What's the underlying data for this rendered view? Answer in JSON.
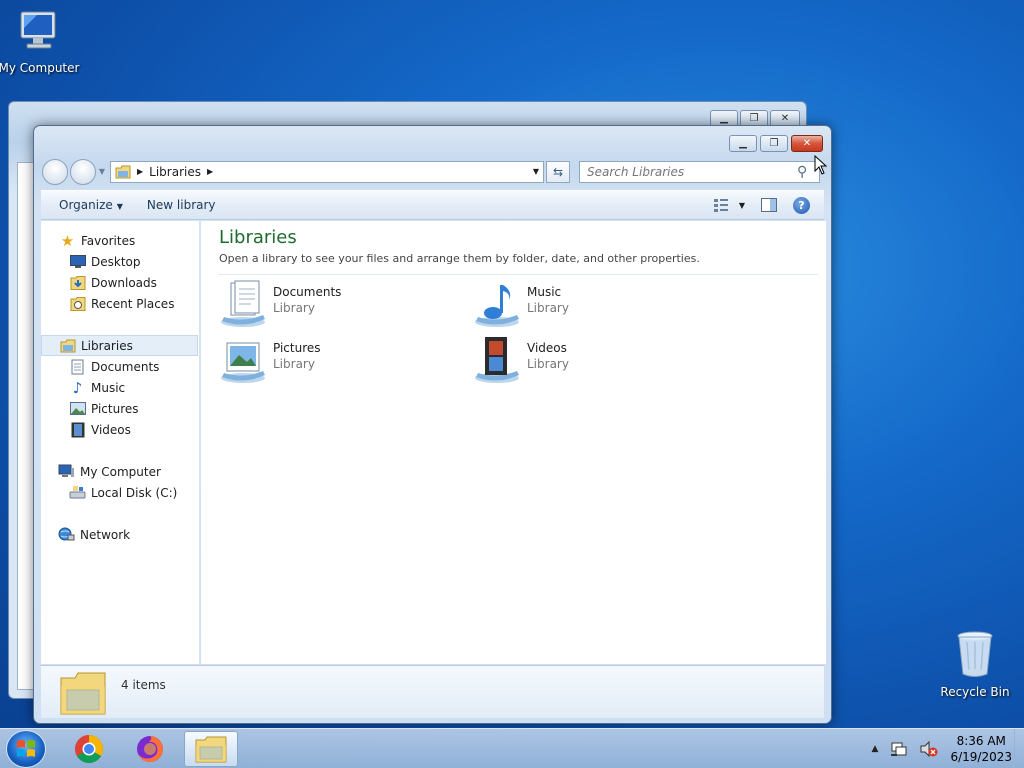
{
  "desktop": {
    "my_computer_label": "My Computer",
    "recycle_bin_label": "Recycle Bin"
  },
  "window": {
    "address": {
      "crumb": "Libraries"
    },
    "search": {
      "placeholder": "Search Libraries"
    },
    "toolbar": {
      "organize": "Organize",
      "new_library": "New library"
    },
    "nav": {
      "favorites": "Favorites",
      "desktop": "Desktop",
      "downloads": "Downloads",
      "recent_places": "Recent Places",
      "libraries": "Libraries",
      "documents": "Documents",
      "music": "Music",
      "pictures": "Pictures",
      "videos": "Videos",
      "my_computer": "My Computer",
      "local_disk": "Local Disk (C:)",
      "network": "Network"
    },
    "content": {
      "title": "Libraries",
      "subtitle": "Open a library to see your files and arrange them by folder, date, and other properties.",
      "items": [
        {
          "name": "Documents",
          "type": "Library"
        },
        {
          "name": "Music",
          "type": "Library"
        },
        {
          "name": "Pictures",
          "type": "Library"
        },
        {
          "name": "Videos",
          "type": "Library"
        }
      ]
    },
    "details": {
      "count": "4 items"
    }
  },
  "taskbar": {
    "clock": {
      "time": "8:36 AM",
      "date": "6/19/2023"
    }
  },
  "colors": {
    "title_green": "#1e6b2f",
    "close_red": "#c83a20",
    "desktop_blue": "#1468c8"
  }
}
